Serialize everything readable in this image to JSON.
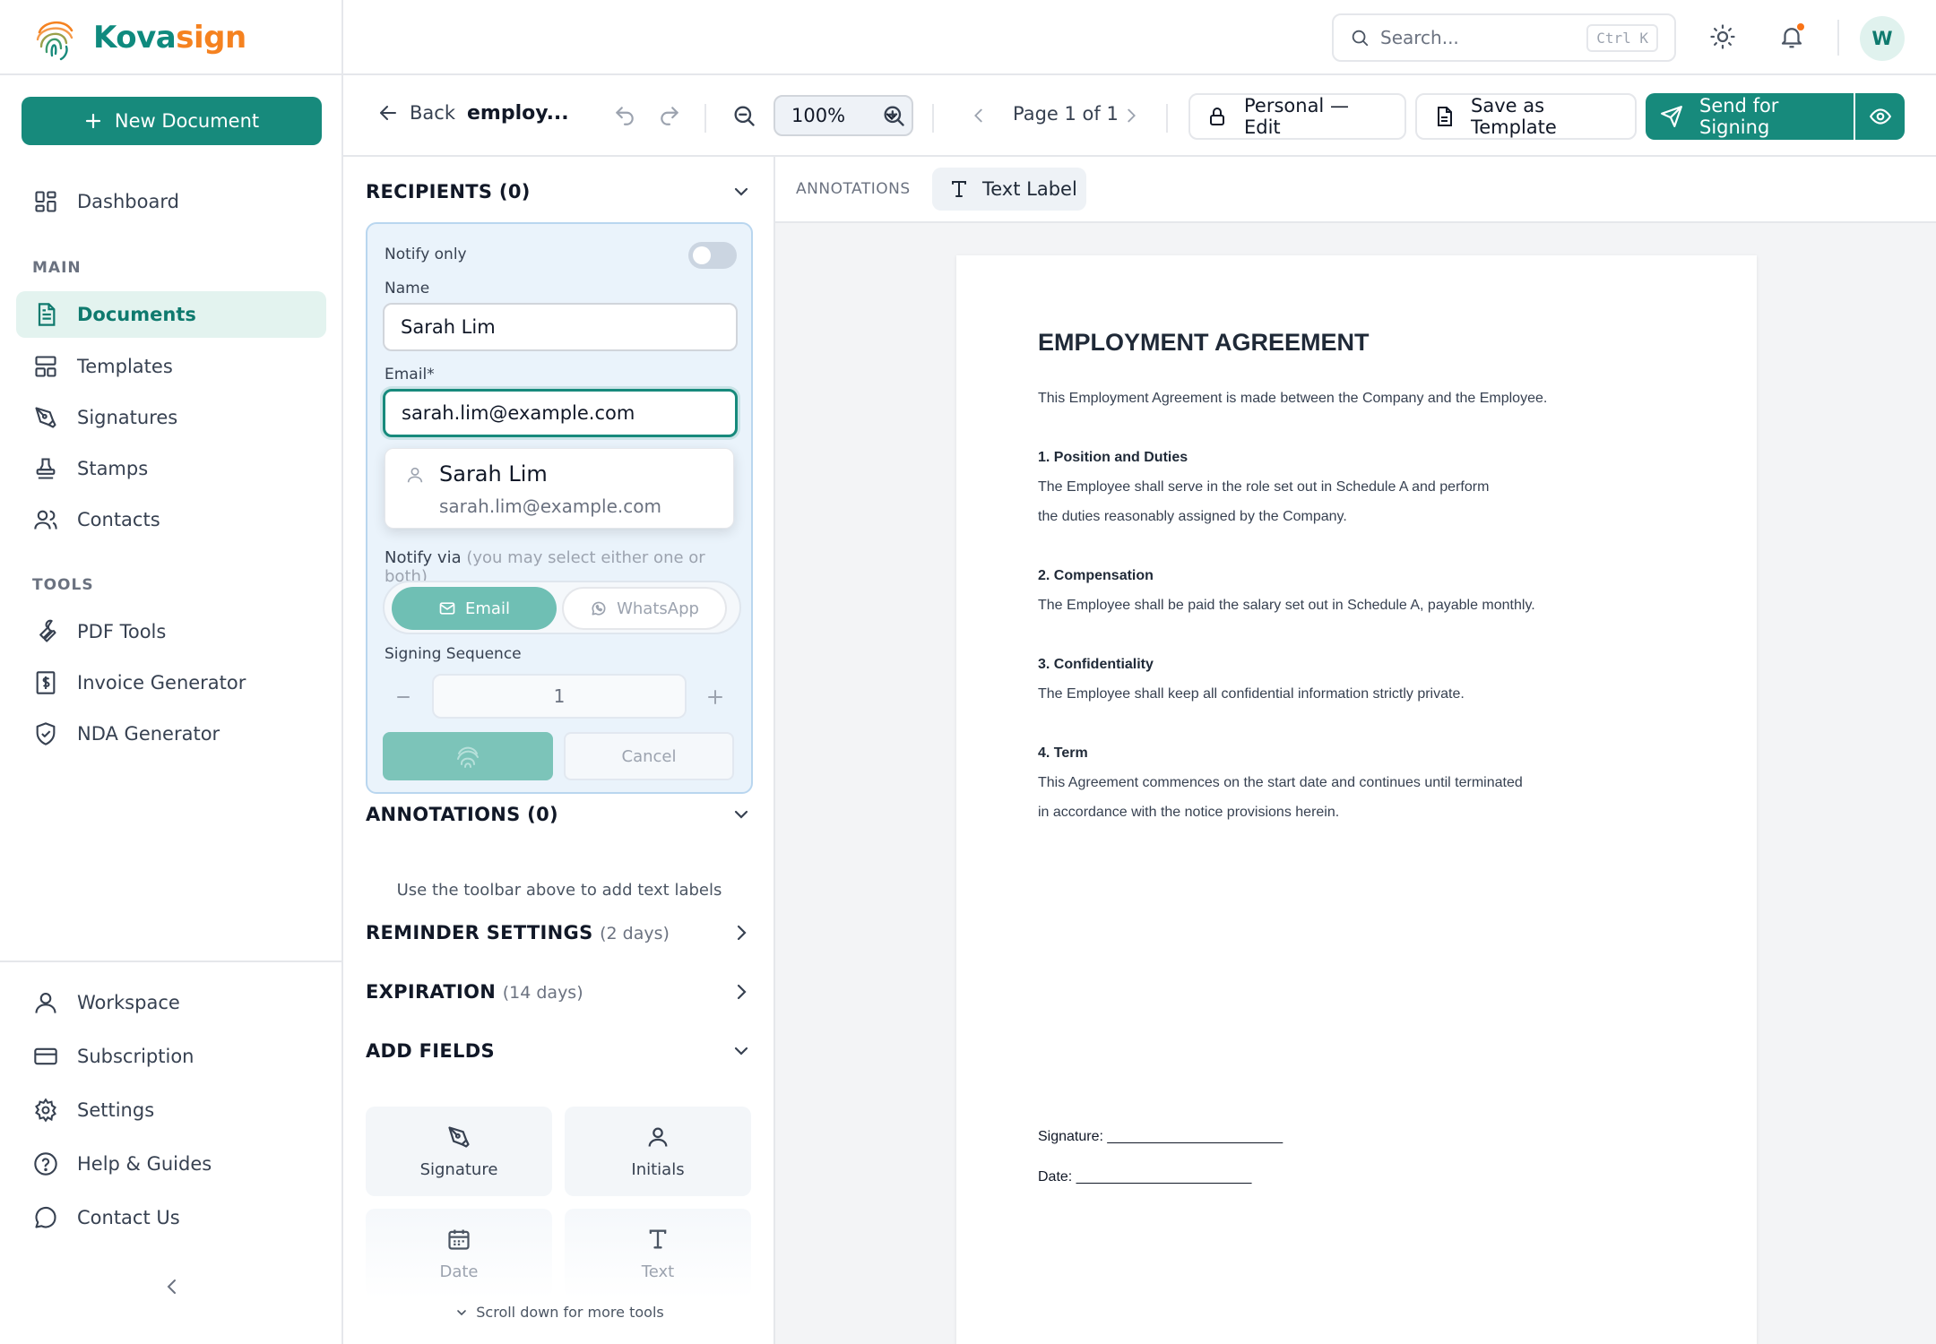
{
  "brand": {
    "name_main": "Kova",
    "name_accent": "sign",
    "colors": {
      "primary": "#178a7c",
      "accent": "#f58220"
    }
  },
  "sidebar": {
    "new_document": "New Document",
    "dashboard": "Dashboard",
    "main_label": "MAIN",
    "main_items": [
      {
        "label": "Documents",
        "icon": "document-icon",
        "active": true
      },
      {
        "label": "Templates",
        "icon": "template-icon"
      },
      {
        "label": "Signatures",
        "icon": "pen-icon"
      },
      {
        "label": "Stamps",
        "icon": "stamp-icon"
      },
      {
        "label": "Contacts",
        "icon": "users-icon"
      }
    ],
    "tools_label": "TOOLS",
    "tool_items": [
      {
        "label": "PDF Tools",
        "icon": "wrench-icon"
      },
      {
        "label": "Invoice Generator",
        "icon": "invoice-icon"
      },
      {
        "label": "NDA Generator",
        "icon": "shield-icon"
      }
    ],
    "bottom_items": [
      {
        "label": "Workspace",
        "icon": "user-icon"
      },
      {
        "label": "Subscription",
        "icon": "card-icon"
      },
      {
        "label": "Settings",
        "icon": "gear-icon"
      },
      {
        "label": "Help & Guides",
        "icon": "help-icon"
      },
      {
        "label": "Contact Us",
        "icon": "chat-icon"
      }
    ]
  },
  "topbar": {
    "search_placeholder": "Search...",
    "shortcut": "Ctrl K",
    "avatar_initial": "W"
  },
  "toolbar": {
    "back": "Back",
    "doc_title": "employ...",
    "zoom": "100%",
    "page_indicator": "Page 1 of 1",
    "access": "Personal — Edit",
    "save_template": "Save as Template",
    "send": "Send for Signing"
  },
  "panel": {
    "recipients_title": "RECIPIENTS (0)",
    "notify_only": "Notify only",
    "name_label": "Name",
    "name_value": "Sarah Lim",
    "email_label": "Email*",
    "email_value": "sarah.lim@example.com",
    "suggestion": {
      "name": "Sarah Lim",
      "email": "sarah.lim@example.com"
    },
    "notify_via": "Notify via",
    "notify_via_hint": "(you may select either one or both)",
    "channel_email": "Email",
    "channel_whatsapp": "WhatsApp",
    "signing_sequence_label": "Signing Sequence",
    "signing_sequence_value": "1",
    "cancel": "Cancel",
    "annotations_title": "ANNOTATIONS (0)",
    "annotations_hint": "Use the toolbar above to add text labels",
    "reminder_title": "REMINDER SETTINGS",
    "reminder_sub": "(2 days)",
    "expiration_title": "EXPIRATION",
    "expiration_sub": "(14 days)",
    "add_fields_title": "ADD FIELDS",
    "fields": [
      "Signature",
      "Initials",
      "Date",
      "Text"
    ],
    "scroll_hint": "Scroll down for more tools"
  },
  "canvas": {
    "annotations_label": "ANNOTATIONS",
    "text_label_button": "Text Label"
  },
  "document": {
    "title": "EMPLOYMENT AGREEMENT",
    "intro": "This Employment Agreement is made between the Company and the Employee.",
    "s1_title": "1. Position and Duties",
    "s1_l1": "The Employee shall serve in the role set out in Schedule A and perform",
    "s1_l2": "the duties reasonably assigned by the Company.",
    "s2_title": "2. Compensation",
    "s2_l1": "The Employee shall be paid the salary set out in Schedule A, payable monthly.",
    "s3_title": "3. Confidentiality",
    "s3_l1": "The Employee shall keep all confidential information strictly private.",
    "s4_title": "4. Term",
    "s4_l1": "This Agreement commences on the start date and continues until terminated",
    "s4_l2": "in accordance with the notice provisions herein.",
    "signature_line": "Signature: ______________________",
    "date_line": "Date: ______________________"
  }
}
